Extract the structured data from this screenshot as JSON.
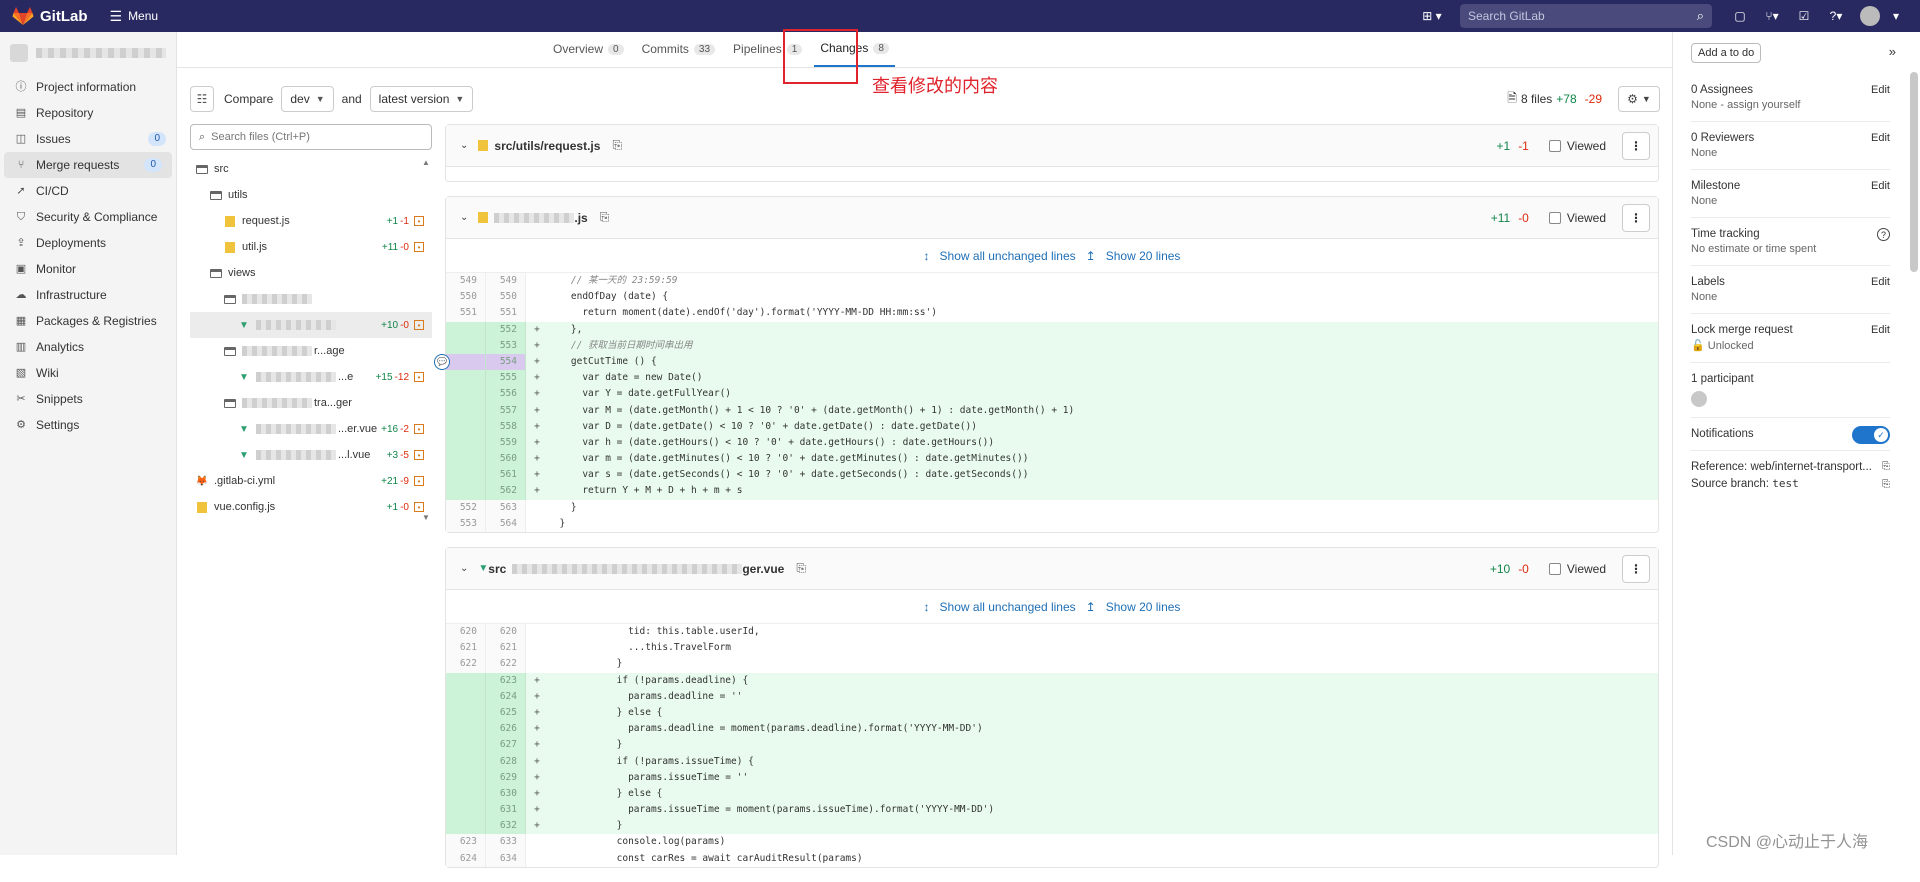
{
  "topbar": {
    "brand": "GitLab",
    "menu_label": "Menu",
    "search_placeholder": "Search GitLab"
  },
  "sidebar": {
    "items": [
      {
        "label": "Project information",
        "icon": "info-icon"
      },
      {
        "label": "Repository",
        "icon": "book-icon"
      },
      {
        "label": "Issues",
        "icon": "issues-icon",
        "badge": "0"
      },
      {
        "label": "Merge requests",
        "icon": "merge-request-icon",
        "badge": "0",
        "active": true
      },
      {
        "label": "CI/CD",
        "icon": "rocket-icon"
      },
      {
        "label": "Security & Compliance",
        "icon": "shield-icon"
      },
      {
        "label": "Deployments",
        "icon": "deployments-icon"
      },
      {
        "label": "Monitor",
        "icon": "monitor-icon"
      },
      {
        "label": "Infrastructure",
        "icon": "cloud-icon"
      },
      {
        "label": "Packages & Registries",
        "icon": "package-icon"
      },
      {
        "label": "Analytics",
        "icon": "chart-icon"
      },
      {
        "label": "Wiki",
        "icon": "wiki-icon"
      },
      {
        "label": "Snippets",
        "icon": "scissors-icon"
      },
      {
        "label": "Settings",
        "icon": "gear-icon"
      }
    ]
  },
  "tabs": [
    {
      "label": "Overview",
      "count": "0"
    },
    {
      "label": "Commits",
      "count": "33"
    },
    {
      "label": "Pipelines",
      "count": "1"
    },
    {
      "label": "Changes",
      "count": "8",
      "active": true
    }
  ],
  "annotation": "查看修改的内容",
  "toolbar": {
    "compare_label": "Compare",
    "source_branch": "dev",
    "and_label": "and",
    "target_branch": "latest version",
    "files_summary": "8 files",
    "additions": "+78",
    "deletions": "-29"
  },
  "filetree": {
    "search_placeholder": "Search files (Ctrl+P)",
    "rows": [
      {
        "name": "src",
        "type": "folder",
        "indent": 0
      },
      {
        "name": "utils",
        "type": "folder",
        "indent": 1
      },
      {
        "name": "request.js",
        "type": "js",
        "indent": 2,
        "add": "+1",
        "del": "-1"
      },
      {
        "name": "util.js",
        "type": "js",
        "indent": 2,
        "add": "+11",
        "del": "-0"
      },
      {
        "name": "views",
        "type": "folder",
        "indent": 1
      },
      {
        "name": "",
        "type": "folder",
        "indent": 2,
        "blurred": true
      },
      {
        "name": "",
        "type": "vue",
        "indent": 3,
        "blurred": true,
        "add": "+10",
        "del": "-0",
        "selected": true
      },
      {
        "name": "r...age",
        "type": "folder",
        "indent": 2,
        "blurred": true
      },
      {
        "name": "...e",
        "type": "vue",
        "indent": 3,
        "blurred": true,
        "add": "+15",
        "del": "-12"
      },
      {
        "name": "tra...ger",
        "type": "folder",
        "indent": 2,
        "blurred": true
      },
      {
        "name": "...er.vue",
        "type": "vue",
        "indent": 3,
        "blurred": true,
        "add": "+16",
        "del": "-2"
      },
      {
        "name": "...l.vue",
        "type": "vue",
        "indent": 3,
        "blurred": true,
        "add": "+3",
        "del": "-5"
      },
      {
        "name": ".gitlab-ci.yml",
        "type": "gitlab",
        "indent": 0,
        "add": "+21",
        "del": "-9"
      },
      {
        "name": "vue.config.js",
        "type": "js",
        "indent": 0,
        "add": "+1",
        "del": "-0"
      }
    ]
  },
  "diff_common": {
    "viewed_label": "Viewed",
    "show_all": "Show all unchanged lines",
    "show_20": "Show 20 lines"
  },
  "files": [
    {
      "name": "src/utils/request.js",
      "add": "+1",
      "del": "-1",
      "collapsed": true
    },
    {
      "name": ".js",
      "add": "+11",
      "del": "-0",
      "blurred": true,
      "lines": [
        {
          "o": "549",
          "n": "549",
          "t": "ctx",
          "code": "    // 某一天的 23:59:59",
          "cls": "cm"
        },
        {
          "o": "550",
          "n": "550",
          "t": "ctx",
          "code": "    endOfDay (date) {"
        },
        {
          "o": "551",
          "n": "551",
          "t": "ctx",
          "code": "      return moment(date).endOf('day').format('YYYY-MM-DD HH:mm:ss')"
        },
        {
          "o": "",
          "n": "552",
          "t": "add",
          "code": "    },"
        },
        {
          "o": "",
          "n": "553",
          "t": "add",
          "code": "    // 获取当前日期时间串出用",
          "cls": "cm"
        },
        {
          "o": "",
          "n": "554",
          "t": "add",
          "code": "    getCutTime () {",
          "hl": true
        },
        {
          "o": "",
          "n": "555",
          "t": "add",
          "code": "      var date = new Date()"
        },
        {
          "o": "",
          "n": "556",
          "t": "add",
          "code": "      var Y = date.getFullYear()"
        },
        {
          "o": "",
          "n": "557",
          "t": "add",
          "code": "      var M = (date.getMonth() + 1 < 10 ? '0' + (date.getMonth() + 1) : date.getMonth() + 1)"
        },
        {
          "o": "",
          "n": "558",
          "t": "add",
          "code": "      var D = (date.getDate() < 10 ? '0' + date.getDate() : date.getDate())"
        },
        {
          "o": "",
          "n": "559",
          "t": "add",
          "code": "      var h = (date.getHours() < 10 ? '0' + date.getHours() : date.getHours())"
        },
        {
          "o": "",
          "n": "560",
          "t": "add",
          "code": "      var m = (date.getMinutes() < 10 ? '0' + date.getMinutes() : date.getMinutes())"
        },
        {
          "o": "",
          "n": "561",
          "t": "add",
          "code": "      var s = (date.getSeconds() < 10 ? '0' + date.getSeconds() : date.getSeconds())"
        },
        {
          "o": "",
          "n": "562",
          "t": "add",
          "code": "      return Y + M + D + h + m + s"
        },
        {
          "o": "552",
          "n": "563",
          "t": "ctx",
          "code": "    }"
        },
        {
          "o": "553",
          "n": "564",
          "t": "ctx",
          "code": "  }"
        }
      ]
    },
    {
      "name": "ger.vue",
      "prefix": "src",
      "add": "+10",
      "del": "-0",
      "blurred": true,
      "lines": [
        {
          "o": "620",
          "n": "620",
          "t": "ctx",
          "code": "              tid: this.table.userId,"
        },
        {
          "o": "621",
          "n": "621",
          "t": "ctx",
          "code": "              ...this.TravelForm"
        },
        {
          "o": "622",
          "n": "622",
          "t": "ctx",
          "code": "            }"
        },
        {
          "o": "",
          "n": "623",
          "t": "add",
          "code": "            if (!params.deadline) {"
        },
        {
          "o": "",
          "n": "624",
          "t": "add",
          "code": "              params.deadline = ''"
        },
        {
          "o": "",
          "n": "625",
          "t": "add",
          "code": "            } else {"
        },
        {
          "o": "",
          "n": "626",
          "t": "add",
          "code": "              params.deadline = moment(params.deadline).format('YYYY-MM-DD')"
        },
        {
          "o": "",
          "n": "627",
          "t": "add",
          "code": "            }"
        },
        {
          "o": "",
          "n": "628",
          "t": "add",
          "code": "            if (!params.issueTime) {"
        },
        {
          "o": "",
          "n": "629",
          "t": "add",
          "code": "              params.issueTime = ''"
        },
        {
          "o": "",
          "n": "630",
          "t": "add",
          "code": "            } else {"
        },
        {
          "o": "",
          "n": "631",
          "t": "add",
          "code": "              params.issueTime = moment(params.issueTime).format('YYYY-MM-DD')"
        },
        {
          "o": "",
          "n": "632",
          "t": "add",
          "code": "            }"
        },
        {
          "o": "623",
          "n": "633",
          "t": "ctx",
          "code": "            console.log(params)"
        },
        {
          "o": "624",
          "n": "634",
          "t": "ctx",
          "code": "            const carRes = await carAuditResult(params)"
        }
      ]
    }
  ],
  "right_panel": {
    "todo": "Add a to do",
    "blocks": [
      {
        "title": "0 Assignees",
        "sub": "None - assign yourself",
        "edit": "Edit"
      },
      {
        "title": "0 Reviewers",
        "sub": "None",
        "edit": "Edit"
      },
      {
        "title": "Milestone",
        "sub": "None",
        "edit": "Edit"
      },
      {
        "title": "Time tracking",
        "sub": "No estimate or time spent",
        "help": true
      },
      {
        "title": "Labels",
        "sub": "None",
        "edit": "Edit"
      },
      {
        "title": "Lock merge request",
        "sub": "Unlocked",
        "edit": "Edit",
        "lock": true
      },
      {
        "title": "1 participant",
        "avatar": true
      },
      {
        "title": "Notifications",
        "toggle": true
      }
    ],
    "reference": "Reference: web/internet-transport...",
    "source_branch": "Source branch:",
    "source_branch_value": "test"
  },
  "watermark": "CSDN @心动止于人海",
  "colors": {
    "accent": "#1f75cb",
    "topbar": "#292961",
    "added": "#108548",
    "removed": "#dd2b0e",
    "annotation": "#e0232c"
  }
}
